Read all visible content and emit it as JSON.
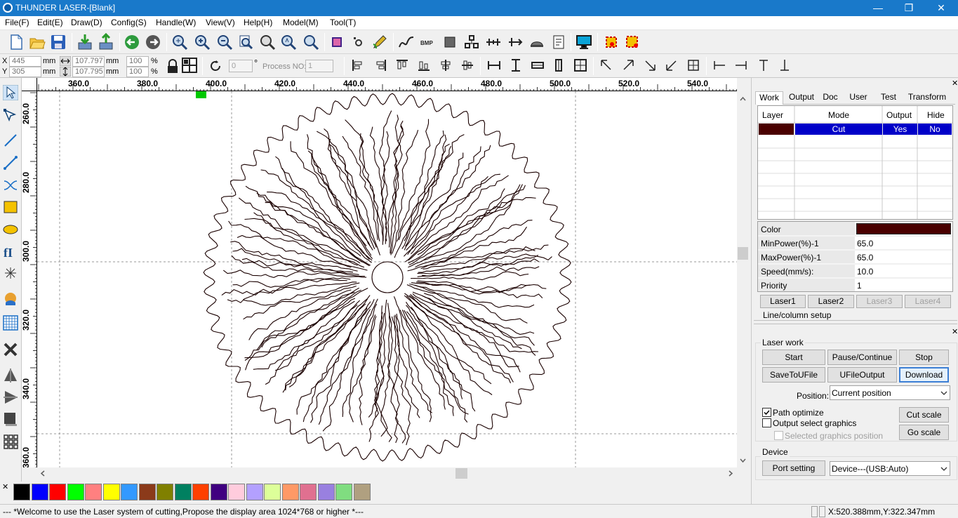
{
  "window": {
    "title": "THUNDER LASER-[Blank]",
    "min_glyph": "—",
    "restore_glyph": "❐",
    "close_glyph": "✕"
  },
  "menu": [
    "File(F)",
    "Edit(E)",
    "Draw(D)",
    "Config(S)",
    "Handle(W)",
    "View(V)",
    "Help(H)",
    "Model(M)",
    "Tool(T)"
  ],
  "props": {
    "x_label": "X",
    "y_label": "Y",
    "x_value": "445",
    "y_value": "305",
    "unit": "mm",
    "w_value": "107.797",
    "h_value": "107.795",
    "w_pct": "100",
    "h_pct": "100",
    "pct": "%",
    "angle": "0",
    "deg": "°",
    "process_label": "Process NO:",
    "process_value": "1"
  },
  "ruler": {
    "top": [
      "360.0",
      "380.0",
      "400.0",
      "420.0",
      "440.0",
      "460.0",
      "480.0",
      "500.0",
      "520.0",
      "540.0"
    ],
    "left": [
      "260.0",
      "280.0",
      "300.0",
      "320.0",
      "340.0",
      "360.0"
    ]
  },
  "panel": {
    "tabs": [
      "Work",
      "Output",
      "Doc",
      "User",
      "Test",
      "Transform"
    ],
    "layer_headers": [
      "Layer",
      "Mode",
      "Output",
      "Hide"
    ],
    "layer_row": {
      "color": "#4a0000",
      "mode": "Cut",
      "output": "Yes",
      "hide": "No"
    },
    "params": [
      {
        "name": "Color",
        "value": ""
      },
      {
        "name": "MinPower(%)-1",
        "value": "65.0"
      },
      {
        "name": "MaxPower(%)-1",
        "value": "65.0"
      },
      {
        "name": "Speed(mm/s):",
        "value": "10.0"
      },
      {
        "name": "Priority",
        "value": "1"
      }
    ],
    "lasers": [
      "Laser1",
      "Laser2",
      "Laser3",
      "Laser4"
    ],
    "line_column": "Line/column setup",
    "laser_work_title": "Laser work",
    "buttons": {
      "start": "Start",
      "pause": "Pause/Continue",
      "stop": "Stop",
      "save": "SaveToUFile",
      "ufile": "UFileOutput",
      "download": "Download",
      "cut_scale": "Cut scale",
      "go_scale": "Go scale",
      "port": "Port setting"
    },
    "position_label": "Position:",
    "position_value": "Current position",
    "path_optimize": "Path optimize",
    "output_select": "Output select graphics",
    "selected_pos": "Selected graphics position",
    "device_title": "Device",
    "device_value": "Device---(USB:Auto)"
  },
  "palette": [
    "#000000",
    "#0000ff",
    "#ff0000",
    "#00ff00",
    "#ff8080",
    "#ffff00",
    "#3399ff",
    "#8b3a1a",
    "#808000",
    "#008060",
    "#ff4000",
    "#400080",
    "#ffccdd",
    "#b3a0ff",
    "#ddff99",
    "#ff9966",
    "#e07090",
    "#9980e0",
    "#80dd80",
    "#b0a080"
  ],
  "status": {
    "message": "--- *Welcome to use the Laser system of cutting,Propose the display area 1024*768 or higher *---",
    "coords": "X:520.388mm,Y:322.347mm"
  },
  "colors": {
    "title_bar": "#1979ca",
    "selection": "#0000c8",
    "layer_color": "#4a0000"
  }
}
